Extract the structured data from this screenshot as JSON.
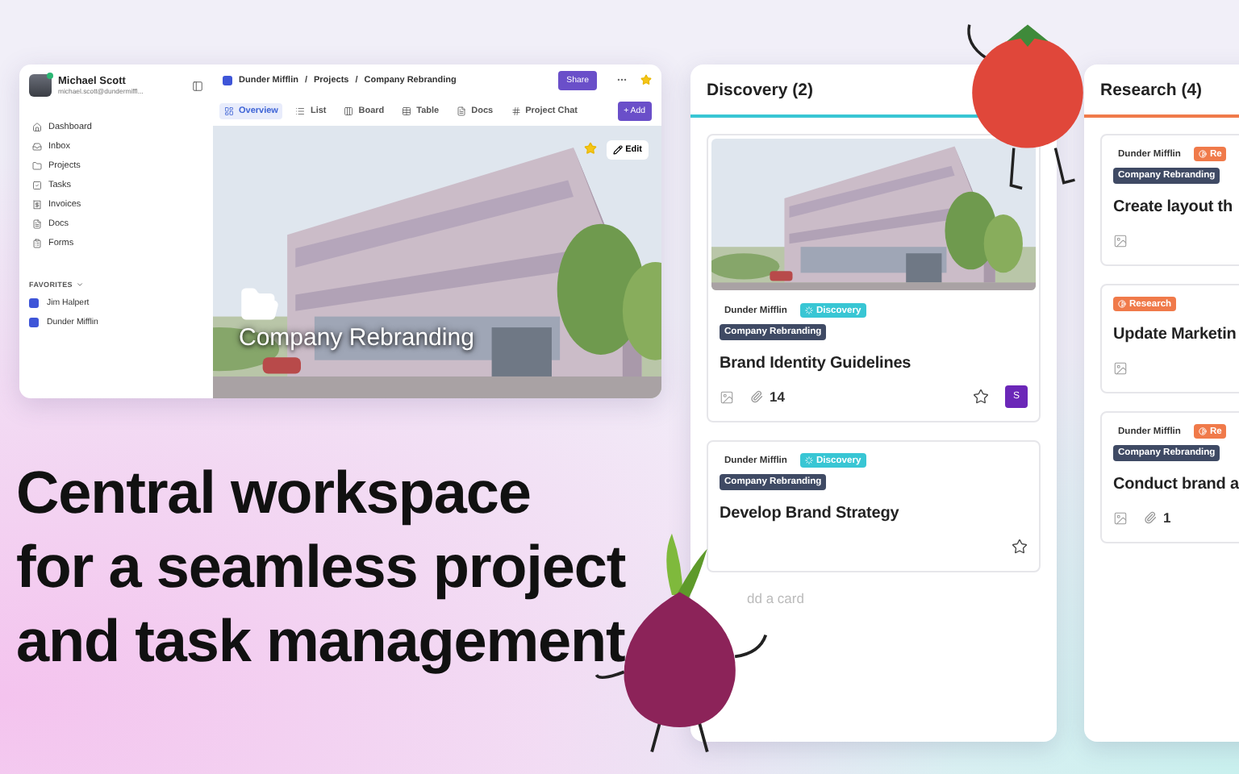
{
  "app": {
    "user": {
      "name": "Michael Scott",
      "email": "michael.scott@dundermiffl..."
    },
    "nav": [
      {
        "label": "Dashboard"
      },
      {
        "label": "Inbox"
      },
      {
        "label": "Projects"
      },
      {
        "label": "Tasks"
      },
      {
        "label": "Invoices"
      },
      {
        "label": "Docs"
      },
      {
        "label": "Forms"
      }
    ],
    "favorites": {
      "label": "FAVORITES",
      "items": [
        {
          "label": "Jim Halpert"
        },
        {
          "label": "Dunder Mifflin"
        }
      ]
    },
    "breadcrumb": {
      "items": [
        "Dunder Mifflin",
        "Projects",
        "Company Rebranding"
      ],
      "separator": "/"
    },
    "share": "Share",
    "tabs": [
      {
        "label": "Overview",
        "selected": true
      },
      {
        "label": "List",
        "selected": false
      },
      {
        "label": "Board",
        "selected": false
      },
      {
        "label": "Table",
        "selected": false
      },
      {
        "label": "Docs",
        "selected": false
      },
      {
        "label": "Project Chat",
        "selected": false
      }
    ],
    "add": "+ Add",
    "cover": {
      "kind": "picture",
      "edit": "Edit",
      "title": "Company Rebranding"
    }
  },
  "headline": [
    "Central workspace",
    "for a seamless project",
    "and task management"
  ],
  "columns": [
    {
      "title": "Discovery (2)",
      "color": "#38c6d4",
      "add_label": "dd a card",
      "cards": [
        {
          "company": "Dunder Mifflin",
          "status": "Discovery",
          "project": "Company Rebranding",
          "title": "Brand Identity Guidelines",
          "has_description": true,
          "attachments": "14",
          "starred": false,
          "assignee": "S"
        },
        {
          "company": "Dunder Mifflin",
          "status": "Discovery",
          "project": "Company Rebranding",
          "title": "Develop Brand Strategy",
          "has_description": false,
          "starred": false
        }
      ]
    },
    {
      "title": "Research (4)",
      "color": "#f07a4a",
      "cards": [
        {
          "company": "Dunder Mifflin",
          "status": "Re",
          "project": "Company Rebranding",
          "title": "Create layout th",
          "has_description": true
        },
        {
          "status": "Research",
          "title": "Update Marketin",
          "has_description": true
        },
        {
          "company": "Dunder Mifflin",
          "status": "Re",
          "project": "Company Rebranding",
          "title": "Conduct brand a",
          "has_description": true,
          "attachments": "1"
        }
      ]
    }
  ]
}
